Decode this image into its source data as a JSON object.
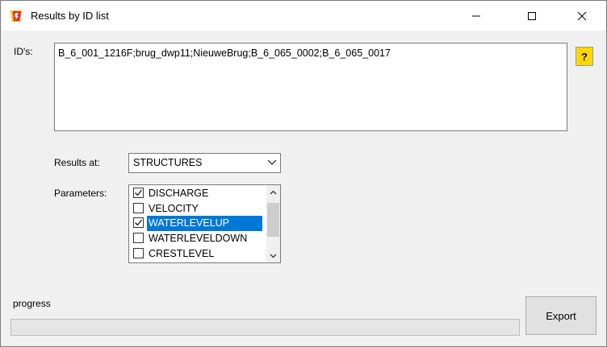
{
  "window": {
    "title": "Results by ID list"
  },
  "ids": {
    "label": "ID's:",
    "value": "B_6_001_1216F;brug_dwp11;NieuweBrug;B_6_065_0002;B_6_065_0017"
  },
  "help_label": "?",
  "results_at": {
    "label": "Results at:",
    "selected": "STRUCTURES"
  },
  "parameters": {
    "label": "Parameters:",
    "items": [
      {
        "label": "DISCHARGE",
        "checked": true,
        "selected": false
      },
      {
        "label": "VELOCITY",
        "checked": false,
        "selected": false
      },
      {
        "label": "WATERLEVELUP",
        "checked": true,
        "selected": true
      },
      {
        "label": "WATERLEVELDOWN",
        "checked": false,
        "selected": false
      },
      {
        "label": "CRESTLEVEL",
        "checked": false,
        "selected": false
      }
    ]
  },
  "progress": {
    "label": "progress",
    "value": 0
  },
  "export_label": "Export",
  "colors": {
    "selection": "#0078d7",
    "help_bg": "#ffd800"
  }
}
